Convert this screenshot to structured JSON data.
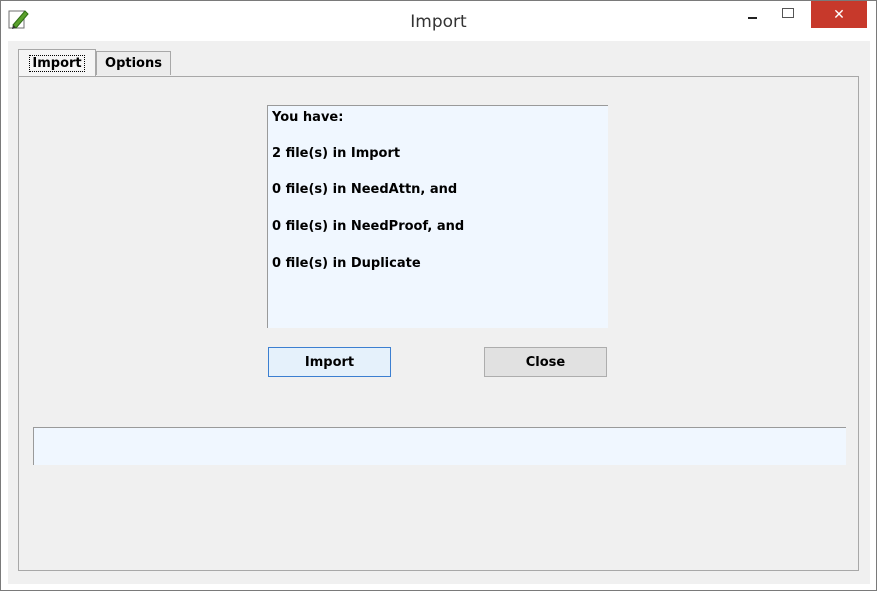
{
  "window": {
    "title": "Import",
    "close_symbol": "✕",
    "icon": "pencil-edit-icon",
    "accent": "#c7392b"
  },
  "tabs": [
    {
      "label": "Import",
      "selected": true
    },
    {
      "label": "Options",
      "selected": false
    }
  ],
  "info": {
    "lines": [
      "You have:",
      "2 file(s) in Import",
      "0 file(s) in NeedAttn, and",
      "0 file(s) in NeedProof, and",
      "0 file(s) in Duplicate"
    ]
  },
  "buttons": {
    "import_label": "Import",
    "close_label": "Close"
  },
  "status": {
    "text": ""
  }
}
